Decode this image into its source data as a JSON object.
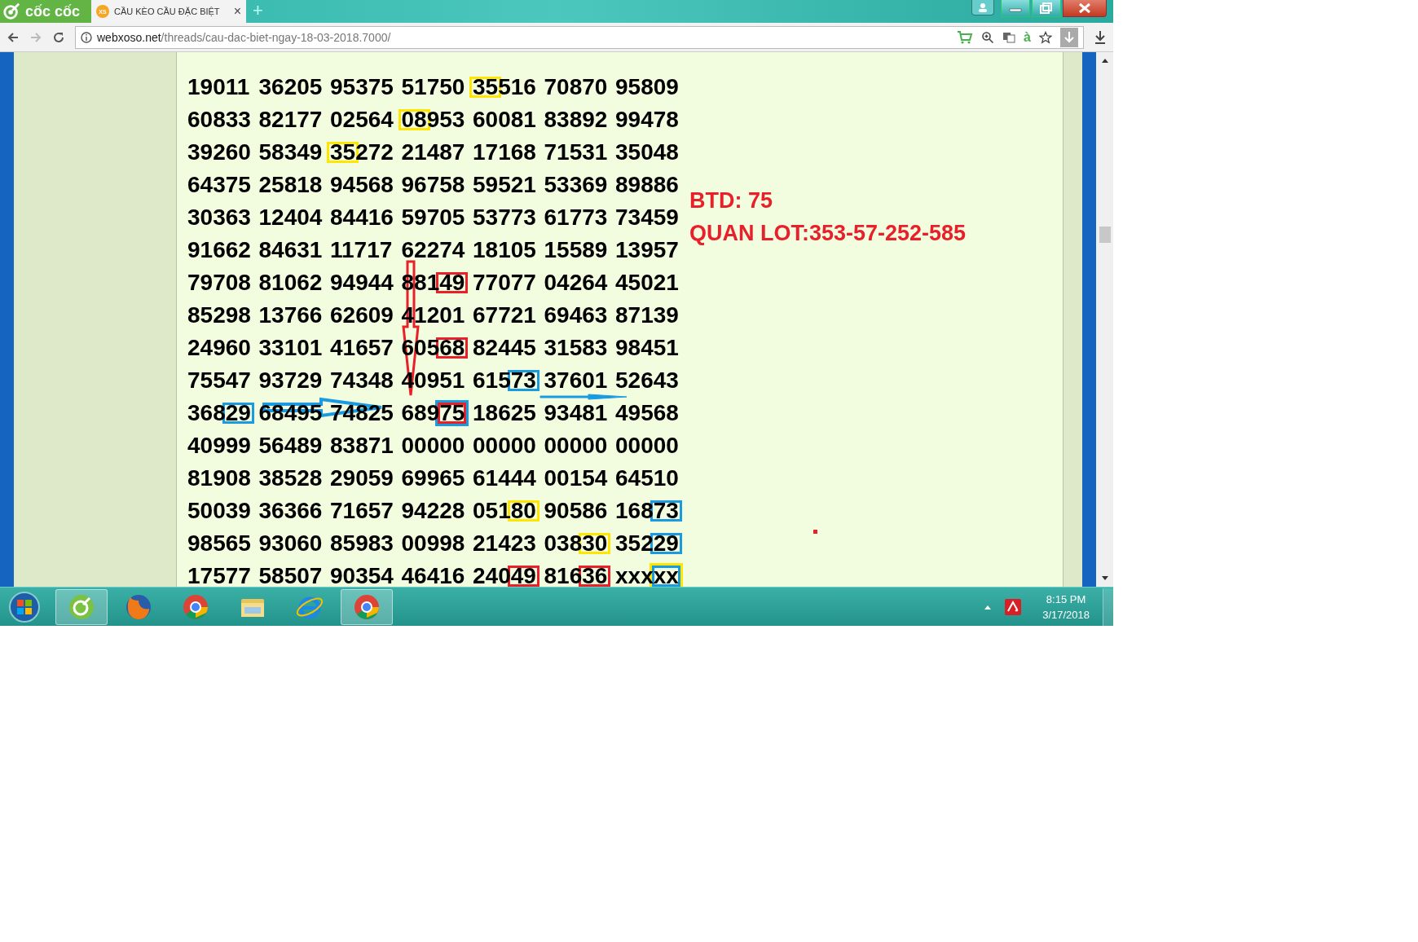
{
  "browser": {
    "name": "cốc cốc",
    "tab": {
      "icon_text": "XS",
      "title": "CẦU KÈO CẦU ĐẶC BIỆT",
      "close": "×"
    },
    "new_tab": "+",
    "address": {
      "domain": "webxoso.net",
      "path": "/threads/cau-dac-biet-ngay-18-03-2018.7000/"
    },
    "translit_button": "à"
  },
  "grid": {
    "rows": [
      {
        "cells": [
          {
            "text": "19011"
          },
          {
            "text": "36205"
          },
          {
            "text": "95375"
          },
          {
            "text": "51750"
          },
          {
            "text": "35516",
            "boxes": [
              {
                "kind": "leading",
                "color": "#ffe600"
              }
            ]
          },
          {
            "text": "70870"
          },
          {
            "text": "95809"
          }
        ]
      },
      {
        "cells": [
          {
            "text": "60833"
          },
          {
            "text": "82177"
          },
          {
            "text": "02564"
          },
          {
            "text": "08953",
            "boxes": [
              {
                "kind": "leading",
                "color": "#ffe600"
              }
            ]
          },
          {
            "text": "60081"
          },
          {
            "text": "83892"
          },
          {
            "text": "99478"
          }
        ]
      },
      {
        "cells": [
          {
            "text": "39260"
          },
          {
            "text": "58349"
          },
          {
            "text": "35272",
            "boxes": [
              {
                "kind": "leading",
                "color": "#ffe600"
              }
            ]
          },
          {
            "text": "21487"
          },
          {
            "text": "17168"
          },
          {
            "text": "71531"
          },
          {
            "text": "35048"
          }
        ]
      },
      {
        "cells": [
          {
            "text": "64375"
          },
          {
            "text": "25818"
          },
          {
            "text": "94568"
          },
          {
            "text": "96758"
          },
          {
            "text": "59521"
          },
          {
            "text": "53369"
          },
          {
            "text": "89886"
          }
        ]
      },
      {
        "cells": [
          {
            "text": "30363"
          },
          {
            "text": "12404"
          },
          {
            "text": "84416"
          },
          {
            "text": "59705"
          },
          {
            "text": "53773"
          },
          {
            "text": "61773"
          },
          {
            "text": "73459"
          }
        ]
      },
      {
        "cells": [
          {
            "text": "91662"
          },
          {
            "text": "84631"
          },
          {
            "text": "11717"
          },
          {
            "text": "62274"
          },
          {
            "text": "18105"
          },
          {
            "text": "15589"
          },
          {
            "text": "13957"
          }
        ]
      },
      {
        "cells": [
          {
            "text": "79708"
          },
          {
            "text": "81062"
          },
          {
            "text": "94944"
          },
          {
            "text": "88149",
            "boxes": [
              {
                "kind": "trailing",
                "color": "#e8202a"
              }
            ]
          },
          {
            "text": "77077"
          },
          {
            "text": "04264"
          },
          {
            "text": "45021"
          }
        ]
      },
      {
        "cells": [
          {
            "text": "85298"
          },
          {
            "text": "13766"
          },
          {
            "text": "62609"
          },
          {
            "text": "41201"
          },
          {
            "text": "67721"
          },
          {
            "text": "69463"
          },
          {
            "text": "87139"
          }
        ]
      },
      {
        "cells": [
          {
            "text": "24960"
          },
          {
            "text": "33101"
          },
          {
            "text": "41657"
          },
          {
            "text": "60568",
            "boxes": [
              {
                "kind": "trailing",
                "color": "#e8202a"
              }
            ]
          },
          {
            "text": "82445"
          },
          {
            "text": "31583"
          },
          {
            "text": "98451"
          }
        ]
      },
      {
        "cells": [
          {
            "text": "75547"
          },
          {
            "text": "93729"
          },
          {
            "text": "74348"
          },
          {
            "text": "40951"
          },
          {
            "text": "61573",
            "boxes": [
              {
                "kind": "trailing",
                "color": "#1a9be0"
              }
            ]
          },
          {
            "text": "37601"
          },
          {
            "text": "52643"
          }
        ]
      },
      {
        "cells": [
          {
            "text": "36829",
            "boxes": [
              {
                "kind": "trailing",
                "color": "#1a9be0"
              }
            ]
          },
          {
            "text": "68495"
          },
          {
            "text": "74825"
          },
          {
            "text": "68975",
            "boxes": [
              {
                "kind": "trailing",
                "color": "#1a9be0"
              },
              {
                "kind": "trailing",
                "color": "#e8202a"
              }
            ]
          },
          {
            "text": "18625"
          },
          {
            "text": "93481"
          },
          {
            "text": "49568"
          }
        ]
      },
      {
        "cells": [
          {
            "text": "40999"
          },
          {
            "text": "56489"
          },
          {
            "text": "83871"
          },
          {
            "text": "00000"
          },
          {
            "text": "00000"
          },
          {
            "text": "00000"
          },
          {
            "text": "00000"
          }
        ]
      },
      {
        "cells": [
          {
            "text": "81908"
          },
          {
            "text": "38528"
          },
          {
            "text": "29059"
          },
          {
            "text": "69965"
          },
          {
            "text": "61444"
          },
          {
            "text": "00154"
          },
          {
            "text": "64510"
          }
        ]
      },
      {
        "cells": [
          {
            "text": "50039"
          },
          {
            "text": "36366"
          },
          {
            "text": "71657"
          },
          {
            "text": "94228"
          },
          {
            "text": "05180",
            "boxes": [
              {
                "kind": "trailing",
                "color": "#ffe600"
              }
            ]
          },
          {
            "text": "90586"
          },
          {
            "text": "16873",
            "boxes": [
              {
                "kind": "trailing",
                "color": "#1a9be0"
              }
            ]
          }
        ]
      },
      {
        "cells": [
          {
            "text": "98565"
          },
          {
            "text": "93060"
          },
          {
            "text": "85983"
          },
          {
            "text": "00998"
          },
          {
            "text": "21423"
          },
          {
            "text": "03830",
            "boxes": [
              {
                "kind": "trailing",
                "color": "#ffe600"
              }
            ]
          },
          {
            "text": "35229",
            "boxes": [
              {
                "kind": "trailing",
                "color": "#1a9be0"
              }
            ]
          }
        ]
      },
      {
        "cells": [
          {
            "text": "17577"
          },
          {
            "text": "58507"
          },
          {
            "text": "90354"
          },
          {
            "text": "46416"
          },
          {
            "text": "24049",
            "boxes": [
              {
                "kind": "trailing",
                "color": "#e8202a"
              }
            ]
          },
          {
            "text": "81636",
            "boxes": [
              {
                "kind": "trailing",
                "color": "#e8202a"
              }
            ]
          },
          {
            "text": "xxxxx",
            "boxes": [
              {
                "kind": "trailing",
                "color": "#ffe600"
              },
              {
                "kind": "trailing",
                "color": "#1a9be0"
              }
            ]
          }
        ]
      }
    ]
  },
  "notes": [
    "BTD: 75",
    "QUAN LOT:353-57-252-585"
  ],
  "taskbar": {
    "time": "8:15 PM",
    "date": "3/17/2018"
  }
}
